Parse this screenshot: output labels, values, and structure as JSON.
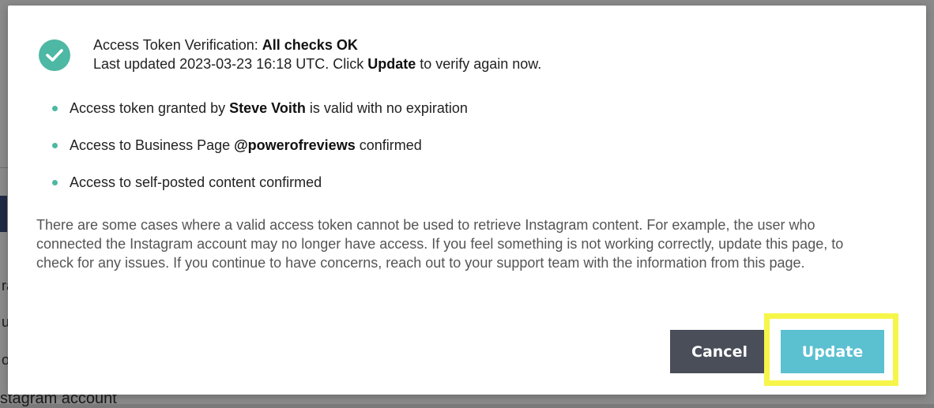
{
  "background": {
    "fragments": [
      "ra",
      "u",
      "o",
      "stagram account"
    ]
  },
  "modal": {
    "status": {
      "title_prefix": "Access Token Verification: ",
      "title_status": "All checks OK",
      "updated_prefix": "Last updated 2023-03-23 16:18 UTC. Click ",
      "updated_action": "Update",
      "updated_suffix": " to verify again now."
    },
    "checks": [
      {
        "prefix": "Access token granted by ",
        "bold": "Steve Voith",
        "suffix": " is valid with no expiration"
      },
      {
        "prefix": "Access to Business Page ",
        "bold": "@powerofreviews",
        "suffix": " confirmed"
      },
      {
        "prefix": "Access to self-posted content confirmed",
        "bold": "",
        "suffix": ""
      }
    ],
    "help_text": "There are some cases where a valid access token cannot be used to retrieve Instagram content. For example, the user who connected the Instagram account may no longer have access. If you feel something is not working correctly, update this page, to check for any issues. If you continue to have concerns, reach out to your support team with the information from this page.",
    "buttons": {
      "cancel_label": "Cancel",
      "update_label": "Update"
    }
  },
  "colors": {
    "accent_teal": "#4db8a3",
    "update_button": "#5bc0d0",
    "cancel_button": "#4a4e59",
    "highlight": "#f6f64a"
  }
}
